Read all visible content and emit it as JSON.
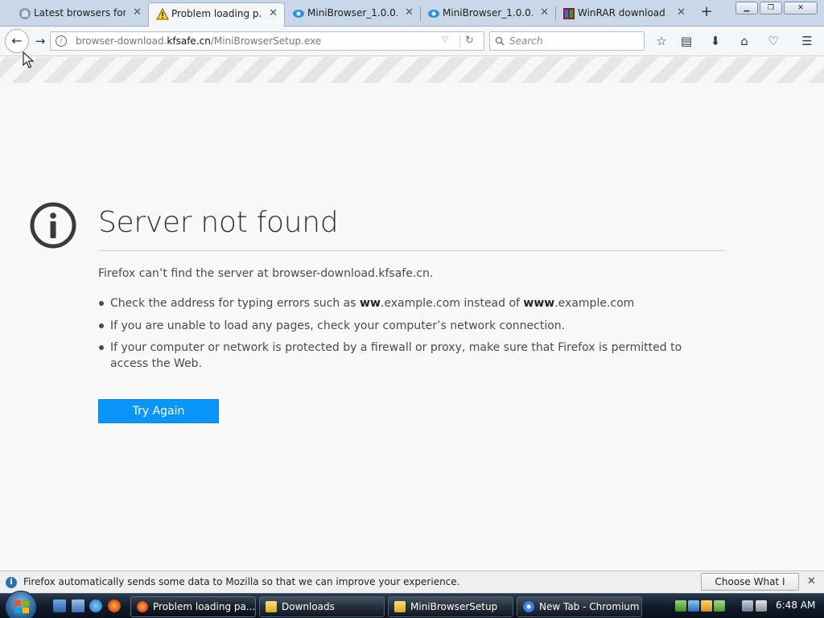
{
  "browser": {
    "tabs": [
      {
        "title": "Latest browsers for ...",
        "icon": "page-favicon",
        "selected": false
      },
      {
        "title": "Problem loading p...",
        "icon": "warning-icon",
        "selected": true
      },
      {
        "title": "MiniBrowser_1.0.0....",
        "icon": "minibrowser-favicon",
        "selected": false
      },
      {
        "title": "MiniBrowser_1.0.0....",
        "icon": "minibrowser-favicon",
        "selected": false
      },
      {
        "title": "WinRAR download ...",
        "icon": "winrar-favicon",
        "selected": false
      }
    ],
    "tab_close_glyph": "✕",
    "new_tab_glyph": "+",
    "window_buttons": {
      "minimize": "▁",
      "maximize": "❐",
      "close": "✕"
    },
    "nav": {
      "back_glyph": "←",
      "forward_glyph": "→",
      "url_host": "browser-download.",
      "url_domain": "kfsafe.cn",
      "url_path": "/MiniBrowserSetup.exe",
      "url_dropdown_glyph": "▽",
      "reload_glyph": "↻",
      "search_placeholder": "Search",
      "toolbar_icons": [
        "bookmark-star-icon",
        "reading-list-icon",
        "downloads-icon",
        "home-icon",
        "pocket-icon",
        "menu-icon"
      ],
      "toolbar_glyphs": [
        "☆",
        "▤",
        "⬇",
        "⌂",
        "♡",
        "☰"
      ]
    }
  },
  "error_page": {
    "title": "Server not found",
    "description": "Firefox can’t find the server at browser-download.kfsafe.cn.",
    "suggestion1_prefix": "Check the address for typing errors such as ",
    "suggestion1_bold1": "ww",
    "suggestion1_mid": ".example.com instead of ",
    "suggestion1_bold2": "www",
    "suggestion1_suffix": ".example.com",
    "suggestion2": "If you are unable to load any pages, check your computer’s network connection.",
    "suggestion3": "If your computer or network is protected by a firewall or proxy, make sure that Firefox is permitted to access the Web.",
    "try_again_label": "Try Again"
  },
  "notification": {
    "text": "Firefox automatically sends some data to Mozilla so that we can improve your experience.",
    "button_label": "Choose What I Share",
    "close_glyph": "✕",
    "info_glyph": "i"
  },
  "taskbar": {
    "tasks": [
      {
        "label": "Problem loading pa...",
        "icon": "firefox-icon",
        "active": true
      },
      {
        "label": "Downloads",
        "icon": "folder-icon",
        "active": false
      },
      {
        "label": "MiniBrowserSetup",
        "icon": "folder-icon",
        "active": false
      },
      {
        "label": "New Tab - Chromium",
        "icon": "chromium-icon",
        "active": false
      }
    ],
    "clock": "6:48 AM"
  },
  "colors": {
    "accent_blue": "#0996f8",
    "tabstrip_bg": "#c9d7e8",
    "page_bg": "#f9f9fa"
  }
}
